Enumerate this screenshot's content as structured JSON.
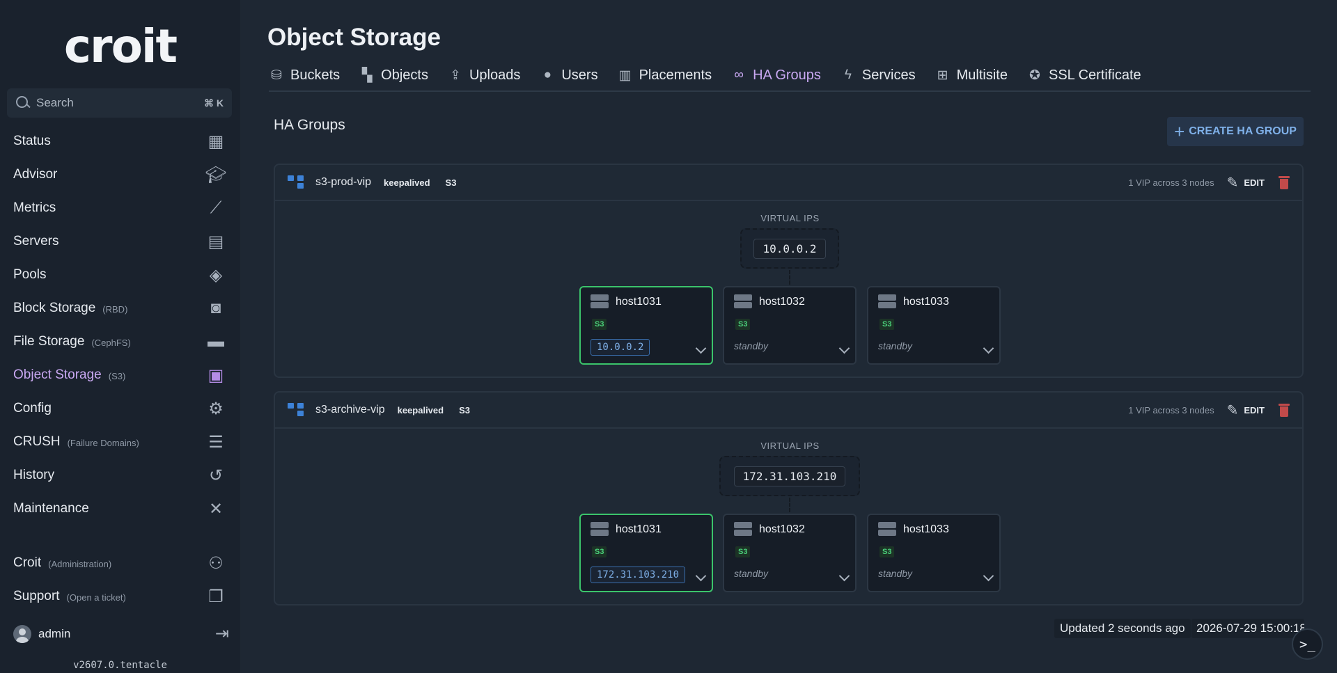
{
  "sidebar": {
    "logo": "croit",
    "search": {
      "placeholder": "Search",
      "shortcut": "⌘ K"
    },
    "items": [
      {
        "label": "Status",
        "sub": "",
        "icon": "dashboard-icon"
      },
      {
        "label": "Advisor",
        "sub": "",
        "icon": "graduation-cap-icon"
      },
      {
        "label": "Metrics",
        "sub": "",
        "icon": "line-chart-icon"
      },
      {
        "label": "Servers",
        "sub": "",
        "icon": "server-icon"
      },
      {
        "label": "Pools",
        "sub": "",
        "icon": "layers-icon"
      },
      {
        "label": "Block Storage",
        "sub": "(RBD)",
        "icon": "disk-icon"
      },
      {
        "label": "File Storage",
        "sub": "(CephFS)",
        "icon": "folder-icon"
      },
      {
        "label": "Object Storage",
        "sub": "(S3)",
        "icon": "boxes-icon",
        "active": true
      },
      {
        "label": "Config",
        "sub": "",
        "icon": "gear-icon"
      },
      {
        "label": "CRUSH",
        "sub": "(Failure Domains)",
        "icon": "tree-list-icon"
      },
      {
        "label": "History",
        "sub": "",
        "icon": "history-icon"
      },
      {
        "label": "Maintenance",
        "sub": "",
        "icon": "tools-icon"
      }
    ],
    "bottom_items": [
      {
        "label": "Croit",
        "sub": "(Administration)",
        "icon": "users-gear-icon"
      },
      {
        "label": "Support",
        "sub": "(Open a ticket)",
        "icon": "chat-icon"
      }
    ],
    "user": {
      "name": "admin"
    },
    "version": "v2607.0.tentacle"
  },
  "page": {
    "title": "Object Storage",
    "tabs": [
      {
        "label": "Buckets",
        "icon": "bucket-icon"
      },
      {
        "label": "Objects",
        "icon": "objects-icon"
      },
      {
        "label": "Uploads",
        "icon": "upload-icon"
      },
      {
        "label": "Users",
        "icon": "user-icon"
      },
      {
        "label": "Placements",
        "icon": "map-icon"
      },
      {
        "label": "HA Groups",
        "icon": "link-icon",
        "active": true
      },
      {
        "label": "Services",
        "icon": "bolt-icon"
      },
      {
        "label": "Multisite",
        "icon": "sitemap-icon"
      },
      {
        "label": "SSL Certificate",
        "icon": "certificate-icon"
      }
    ]
  },
  "section": {
    "title": "HA Groups",
    "create_button": "CREATE HA GROUP"
  },
  "groups": [
    {
      "name": "s3-prod-vip",
      "type": "keepalived",
      "service": "S3",
      "vip_summary": "1 VIP across 3 nodes",
      "edit_label": "EDIT",
      "vip_title": "VIRTUAL IPS",
      "vip": "10.0.0.2",
      "nodes": [
        {
          "host": "host1031",
          "badge": "S3",
          "ip": "10.0.0.2",
          "primary": true
        },
        {
          "host": "host1032",
          "badge": "S3",
          "state": "standby"
        },
        {
          "host": "host1033",
          "badge": "S3",
          "state": "standby"
        }
      ]
    },
    {
      "name": "s3-archive-vip",
      "type": "keepalived",
      "service": "S3",
      "vip_summary": "1 VIP across 3 nodes",
      "edit_label": "EDIT",
      "vip_title": "VIRTUAL IPS",
      "vip": "172.31.103.210",
      "nodes": [
        {
          "host": "host1031",
          "badge": "S3",
          "ip": "172.31.103.210",
          "primary": true
        },
        {
          "host": "host1032",
          "badge": "S3",
          "state": "standby"
        },
        {
          "host": "host1033",
          "badge": "S3",
          "state": "standby"
        }
      ]
    }
  ],
  "status": {
    "updated": "Updated 2 seconds ago",
    "timestamp": "2026-07-29 15:00:18"
  },
  "colors": {
    "accent": "#c9a8f2",
    "primary_border": "#3bc46b",
    "danger": "#c14a4a",
    "link": "#7fb0e8"
  }
}
